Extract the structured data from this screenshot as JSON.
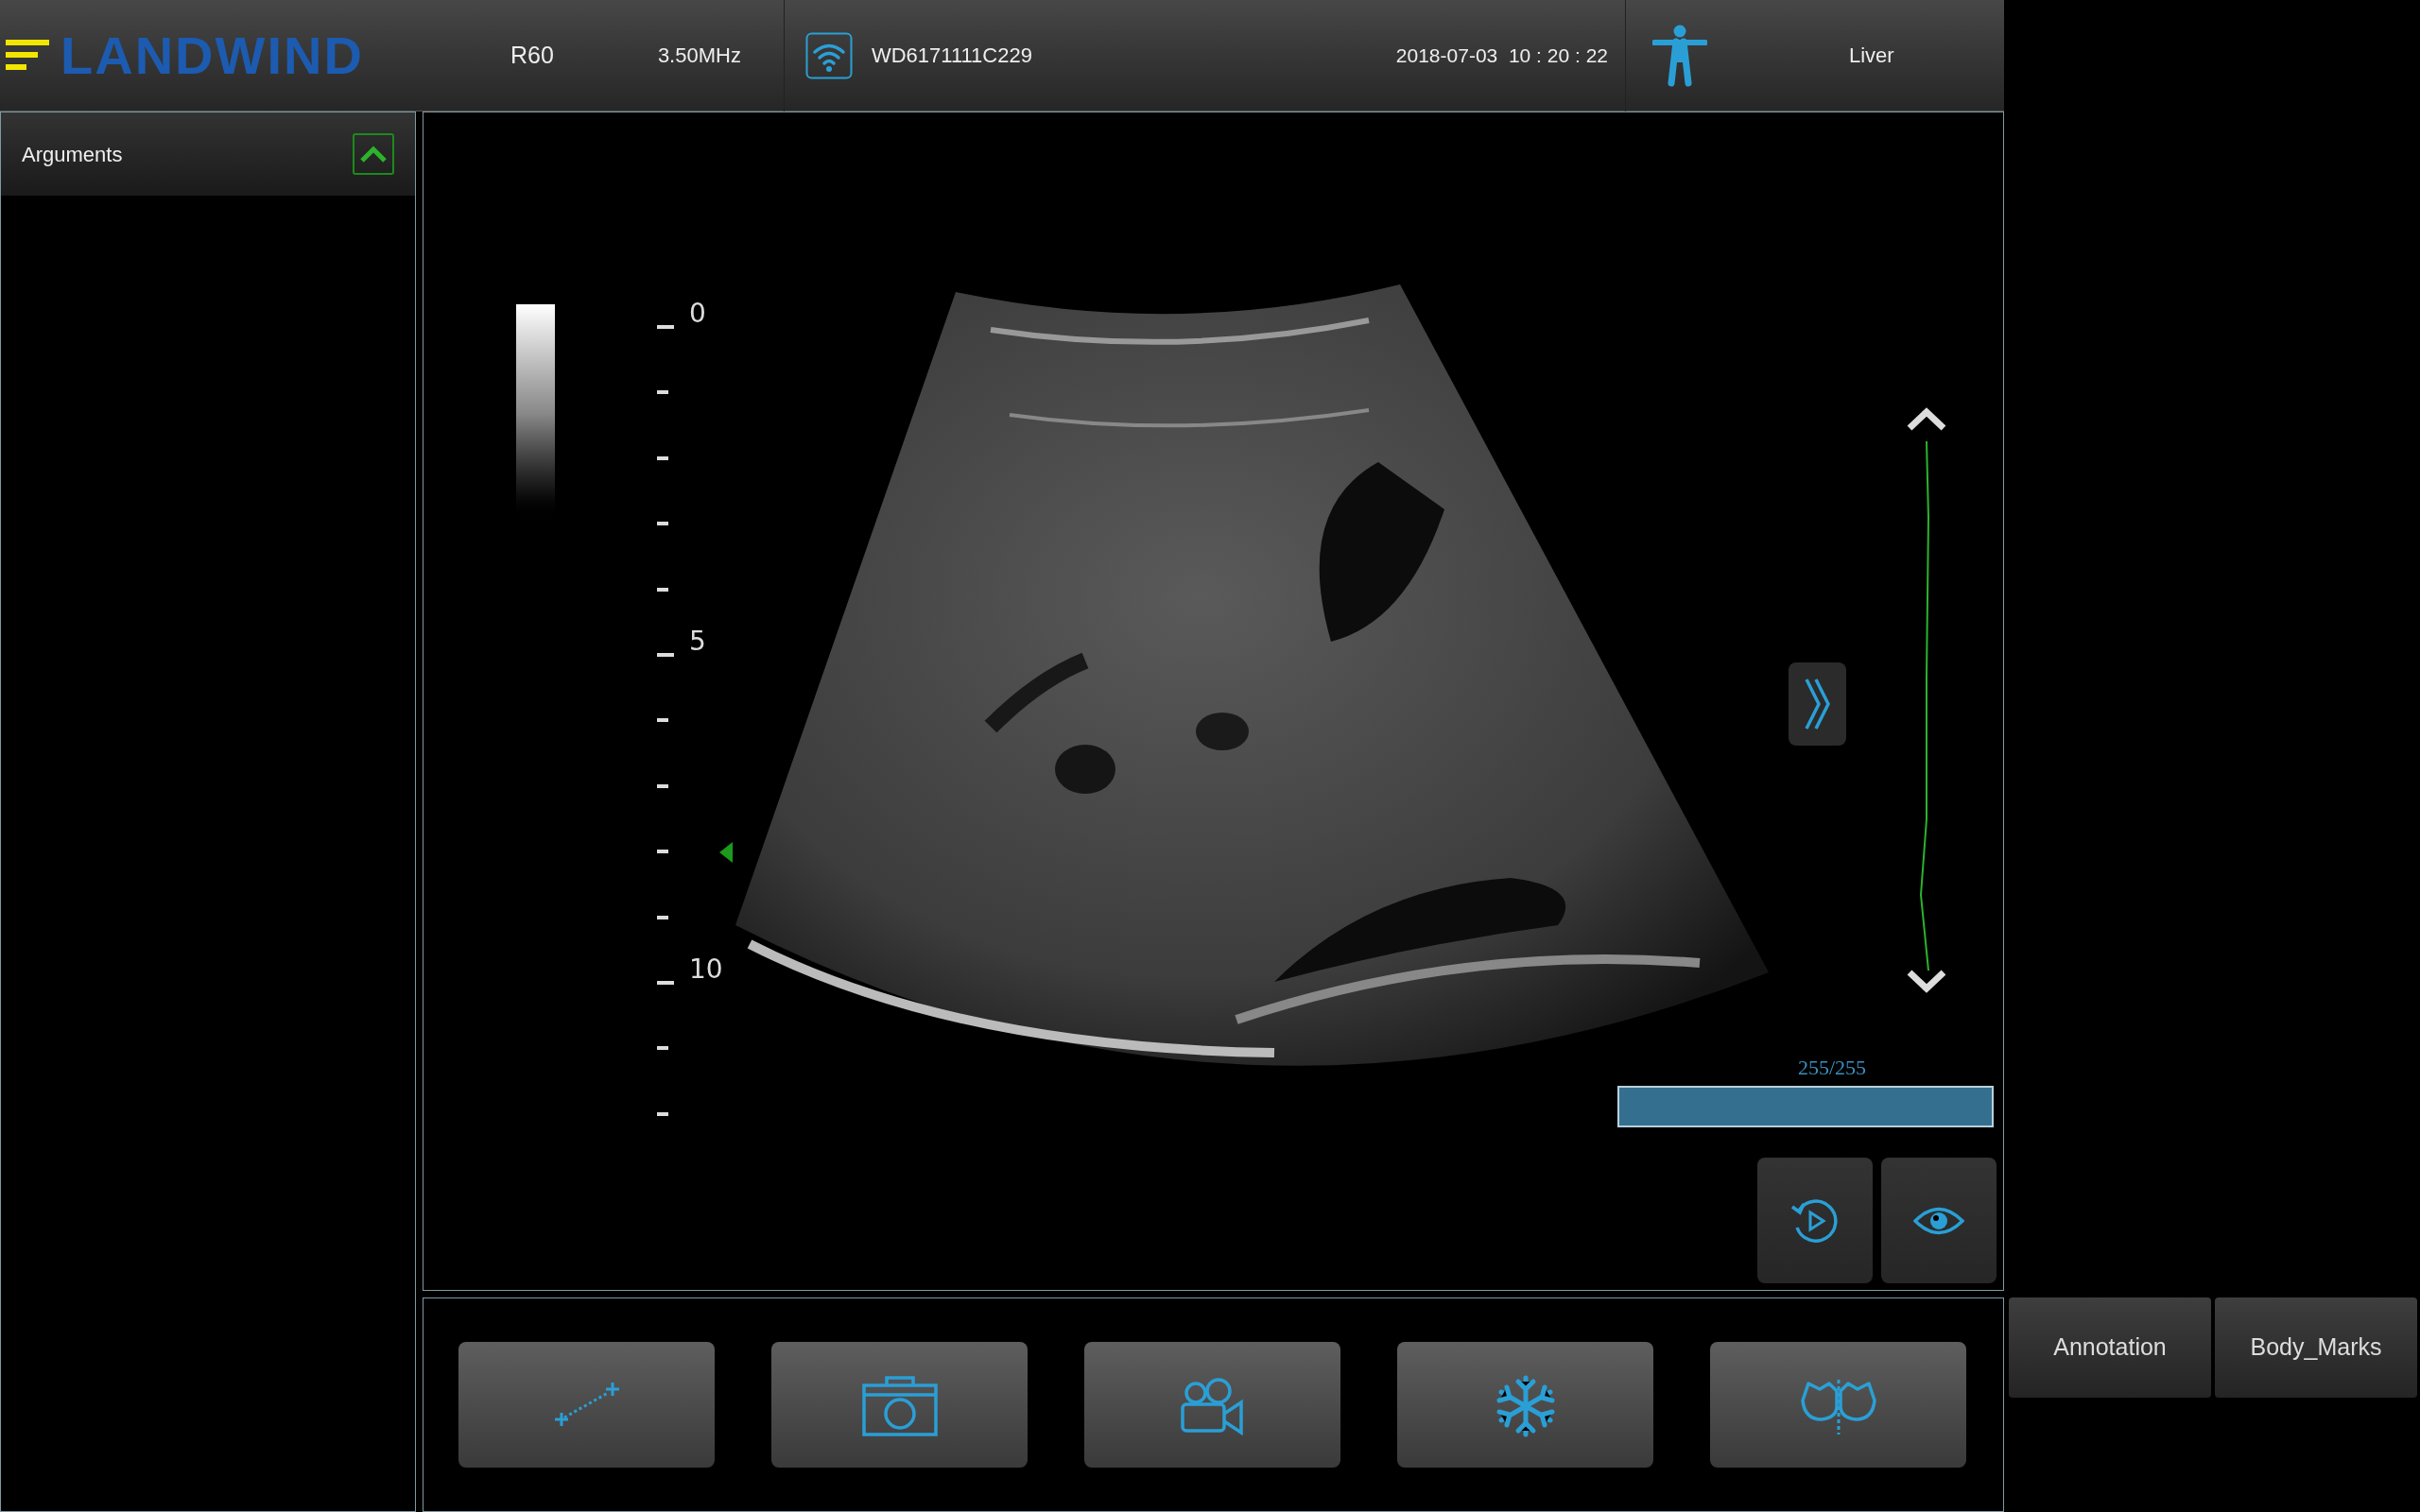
{
  "logo": {
    "text": "LANDWIND"
  },
  "header": {
    "model": "R60",
    "frequency": "3.50MHz",
    "device_id": "WD6171111C229",
    "datetime": "2018-07-03  10 : 20 : 22",
    "exam_preset": "Liver"
  },
  "arguments_panel": {
    "title": "Arguments",
    "expanded": true
  },
  "depth_labels": [
    "0",
    "5",
    "10"
  ],
  "cine": {
    "frame": "255/255",
    "level": 1
  },
  "toolbar_buttons": [
    {
      "kind": "measure"
    },
    {
      "kind": "camera"
    },
    {
      "kind": "video"
    },
    {
      "kind": "freeze"
    },
    {
      "kind": "bodymark"
    }
  ],
  "side_buttons": [
    "Annotation",
    "Body_Marks"
  ]
}
